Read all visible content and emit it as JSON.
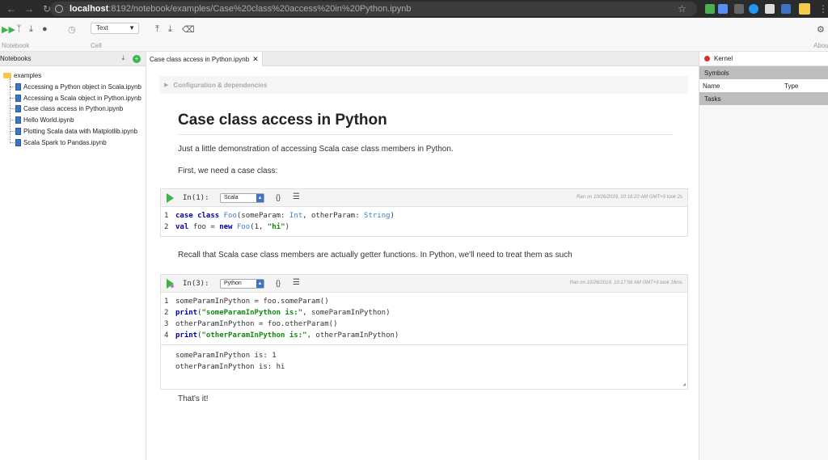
{
  "browser": {
    "url_host": "localhost",
    "url_path": ":8192/notebook/examples/Case%20class%20access%20in%20Python.ipynb"
  },
  "toolbar": {
    "cell_type": "Text",
    "notebook_label": "Notebook",
    "cell_label": "Cell",
    "about_label": "About"
  },
  "left_panel": {
    "header": "Notebooks",
    "folder": "examples",
    "files": [
      "Accessing a Python object in Scala.ipynb",
      "Accessing a Scala object in Python.ipynb",
      "Case class access in Python.ipynb",
      "Hello World.ipynb",
      "Plotting Scala data with Matplotlib.ipynb",
      "Scala Spark to Pandas.ipynb"
    ]
  },
  "tab": {
    "label": "Case class access in Python.ipynb"
  },
  "notebook": {
    "config_label": "Configuration & dependencies",
    "title": "Case class access in Python",
    "p1": "Just a little demonstration of accessing Scala case class members in Python.",
    "p2": "First, we need a  case class:",
    "p3": "Recall that Scala case class members are actually getter functions. In Python, we'll need to treat them as such",
    "p4": "That's it!",
    "cell1": {
      "prompt": "In(1):",
      "language": "Scala",
      "run_info": "Ran on 10/26/2019, 10:16:20 AM GMT+9 took 2s",
      "line_numbers": [
        "1",
        "2"
      ]
    },
    "cell2": {
      "prompt": "In(3):",
      "language": "Python",
      "run_info": "Ran on 10/26/2019, 10:17:56 AM GMT+9 took 16ms",
      "line_numbers": [
        "1",
        "2",
        "3",
        "4"
      ],
      "output": [
        "someParamInPython is: 1",
        "otherParamInPython is: hi"
      ]
    }
  },
  "right_panel": {
    "kernel": "Kernel",
    "symbols": "Symbols",
    "col_name": "Name",
    "col_type": "Type",
    "tasks": "Tasks"
  }
}
